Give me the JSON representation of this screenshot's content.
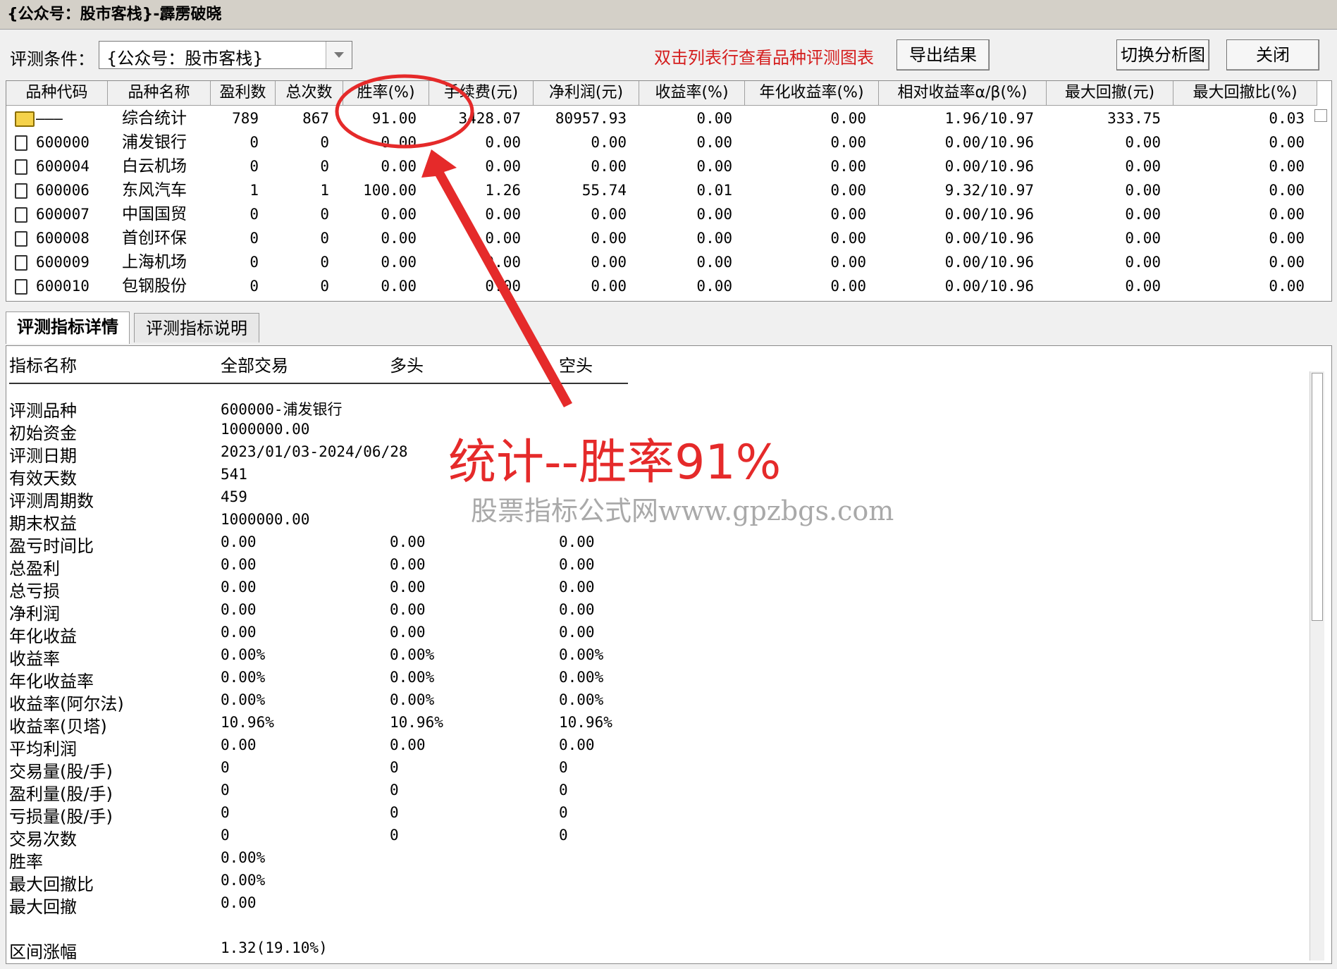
{
  "window": {
    "title": "{公众号：股市客栈}-霹雳破晓"
  },
  "toolbar": {
    "condition_label": "评测条件：",
    "condition_value": "{公众号：股市客栈}",
    "hint": "双击列表行查看品种评测图表",
    "export_label": "导出结果",
    "switch_label": "切换分析图",
    "close_label": "关闭"
  },
  "table": {
    "columns": [
      "品种代码",
      "品种名称",
      "盈利数",
      "总次数",
      "胜率(%)",
      "手续费(元)",
      "净利润(元)",
      "收益率(%)",
      "年化收益率(%)",
      "相对收益率α/β(%)",
      "最大回撤(元)",
      "最大回撤比(%)"
    ],
    "rows": [
      {
        "code": "———",
        "name": "综合统计",
        "win": "789",
        "total": "867",
        "rate": "91.00",
        "fee": "3428.07",
        "profit": "80957.93",
        "ret": "0.00",
        "annual": "0.00",
        "alpha": "1.96/10.97",
        "dd": "333.75",
        "ddr": "0.03"
      },
      {
        "code": "600000",
        "name": "浦发银行",
        "win": "0",
        "total": "0",
        "rate": "0.00",
        "fee": "0.00",
        "profit": "0.00",
        "ret": "0.00",
        "annual": "0.00",
        "alpha": "0.00/10.96",
        "dd": "0.00",
        "ddr": "0.00"
      },
      {
        "code": "600004",
        "name": "白云机场",
        "win": "0",
        "total": "0",
        "rate": "0.00",
        "fee": "0.00",
        "profit": "0.00",
        "ret": "0.00",
        "annual": "0.00",
        "alpha": "0.00/10.96",
        "dd": "0.00",
        "ddr": "0.00"
      },
      {
        "code": "600006",
        "name": "东风汽车",
        "win": "1",
        "total": "1",
        "rate": "100.00",
        "fee": "1.26",
        "profit": "55.74",
        "ret": "0.01",
        "annual": "0.00",
        "alpha": "9.32/10.97",
        "dd": "0.00",
        "ddr": "0.00"
      },
      {
        "code": "600007",
        "name": "中国国贸",
        "win": "0",
        "total": "0",
        "rate": "0.00",
        "fee": "0.00",
        "profit": "0.00",
        "ret": "0.00",
        "annual": "0.00",
        "alpha": "0.00/10.96",
        "dd": "0.00",
        "ddr": "0.00"
      },
      {
        "code": "600008",
        "name": "首创环保",
        "win": "0",
        "total": "0",
        "rate": "0.00",
        "fee": "0.00",
        "profit": "0.00",
        "ret": "0.00",
        "annual": "0.00",
        "alpha": "0.00/10.96",
        "dd": "0.00",
        "ddr": "0.00"
      },
      {
        "code": "600009",
        "name": "上海机场",
        "win": "0",
        "total": "0",
        "rate": "0.00",
        "fee": "0.00",
        "profit": "0.00",
        "ret": "0.00",
        "annual": "0.00",
        "alpha": "0.00/10.96",
        "dd": "0.00",
        "ddr": "0.00"
      },
      {
        "code": "600010",
        "name": "包钢股份",
        "win": "0",
        "total": "0",
        "rate": "0.00",
        "fee": "0.00",
        "profit": "0.00",
        "ret": "0.00",
        "annual": "0.00",
        "alpha": "0.00/10.96",
        "dd": "0.00",
        "ddr": "0.00"
      }
    ]
  },
  "tabs": [
    {
      "label": "评测指标详情",
      "active": true
    },
    {
      "label": "评测指标说明",
      "active": false
    }
  ],
  "details": {
    "headers": [
      "指标名称",
      "全部交易",
      "多头",
      "空头"
    ],
    "rows": [
      {
        "name": "评测品种",
        "all": "600000-浦发银行",
        "long": "",
        "short": ""
      },
      {
        "name": "初始资金",
        "all": "1000000.00",
        "long": "",
        "short": ""
      },
      {
        "name": "评测日期",
        "all": "2023/01/03-2024/06/28",
        "long": "",
        "short": ""
      },
      {
        "name": "有效天数",
        "all": "541",
        "long": "",
        "short": ""
      },
      {
        "name": "评测周期数",
        "all": "459",
        "long": "",
        "short": ""
      },
      {
        "name": "期末权益",
        "all": "1000000.00",
        "long": "",
        "short": ""
      },
      {
        "name": "盈亏时间比",
        "all": "0.00",
        "long": "0.00",
        "short": "0.00"
      },
      {
        "name": "总盈利",
        "all": "0.00",
        "long": "0.00",
        "short": "0.00"
      },
      {
        "name": "总亏损",
        "all": "0.00",
        "long": "0.00",
        "short": "0.00"
      },
      {
        "name": "净利润",
        "all": "0.00",
        "long": "0.00",
        "short": "0.00"
      },
      {
        "name": "年化收益",
        "all": "0.00",
        "long": "0.00",
        "short": "0.00"
      },
      {
        "name": "收益率",
        "all": "0.00%",
        "long": "0.00%",
        "short": "0.00%"
      },
      {
        "name": "年化收益率",
        "all": "0.00%",
        "long": "0.00%",
        "short": "0.00%"
      },
      {
        "name": "收益率(阿尔法)",
        "all": "0.00%",
        "long": "0.00%",
        "short": "0.00%"
      },
      {
        "name": "收益率(贝塔)",
        "all": "10.96%",
        "long": "10.96%",
        "short": "10.96%"
      },
      {
        "name": "平均利润",
        "all": "0.00",
        "long": "0.00",
        "short": "0.00"
      },
      {
        "name": "交易量(股/手)",
        "all": "0",
        "long": "0",
        "short": "0"
      },
      {
        "name": "盈利量(股/手)",
        "all": "0",
        "long": "0",
        "short": "0"
      },
      {
        "name": "亏损量(股/手)",
        "all": "0",
        "long": "0",
        "short": "0"
      },
      {
        "name": "交易次数",
        "all": "0",
        "long": "0",
        "short": "0"
      },
      {
        "name": "胜率",
        "all": "0.00%",
        "long": "",
        "short": ""
      },
      {
        "name": "最大回撤比",
        "all": "0.00%",
        "long": "",
        "short": ""
      },
      {
        "name": "最大回撤",
        "all": "0.00",
        "long": "",
        "short": ""
      },
      {
        "name": "",
        "all": "",
        "long": "",
        "short": ""
      },
      {
        "name": "区间涨幅",
        "all": "1.32(19.10%)",
        "long": "",
        "short": ""
      }
    ]
  },
  "annotation": {
    "text": "统计--胜率91%",
    "watermark": "股票指标公式网www.gpzbgs.com",
    "color": "#e52a2a"
  }
}
